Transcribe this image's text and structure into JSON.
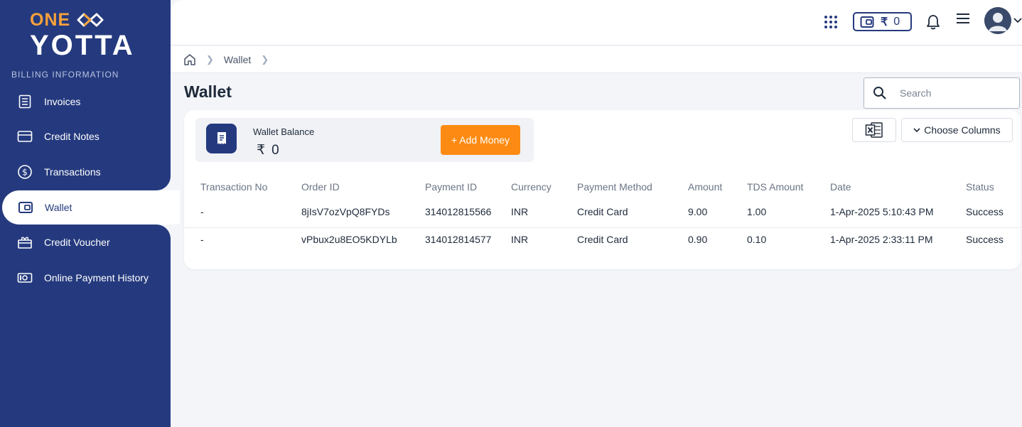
{
  "brand": {
    "logo_one": "ONE",
    "logo_yotta": "YOTTA"
  },
  "sidebar": {
    "section_label": "BILLING INFORMATION",
    "items": [
      {
        "label": "Invoices",
        "icon": "invoice-icon"
      },
      {
        "label": "Credit Notes",
        "icon": "credit-card-icon"
      },
      {
        "label": "Transactions",
        "icon": "dollar-circle-icon"
      },
      {
        "label": "Wallet",
        "icon": "wallet-icon",
        "active": true
      },
      {
        "label": "Credit Voucher",
        "icon": "gift-icon"
      },
      {
        "label": "Online Payment History",
        "icon": "cash-icon"
      }
    ]
  },
  "header": {
    "wallet_currency": "₹",
    "wallet_amount": "0"
  },
  "breadcrumb": {
    "current": "Wallet"
  },
  "page": {
    "title": "Wallet"
  },
  "search": {
    "placeholder": "Search"
  },
  "balance": {
    "label": "Wallet Balance",
    "currency": "₹",
    "amount": "0",
    "add_money_label": "+ Add Money"
  },
  "toolbar": {
    "choose_columns_label": "Choose Columns"
  },
  "table": {
    "columns": [
      "Transaction No",
      "Order ID",
      "Payment ID",
      "Currency",
      "Payment Method",
      "Amount",
      "TDS Amount",
      "Date",
      "Status"
    ],
    "rows": [
      [
        "-",
        "8jIsV7ozVpQ8FYDs",
        "314012815566",
        "INR",
        "Credit Card",
        "9.00",
        "1.00",
        "1-Apr-2025 5:10:43 PM",
        "Success"
      ],
      [
        "-",
        "vPbux2u8EO5KDYLb",
        "314012814577",
        "INR",
        "Credit Card",
        "0.90",
        "0.10",
        "1-Apr-2025 2:33:11 PM",
        "Success"
      ]
    ]
  },
  "colors": {
    "sidebar_bg": "#253a7e",
    "accent_orange": "#fd8b13",
    "logo_orange": "#f7a13a"
  }
}
